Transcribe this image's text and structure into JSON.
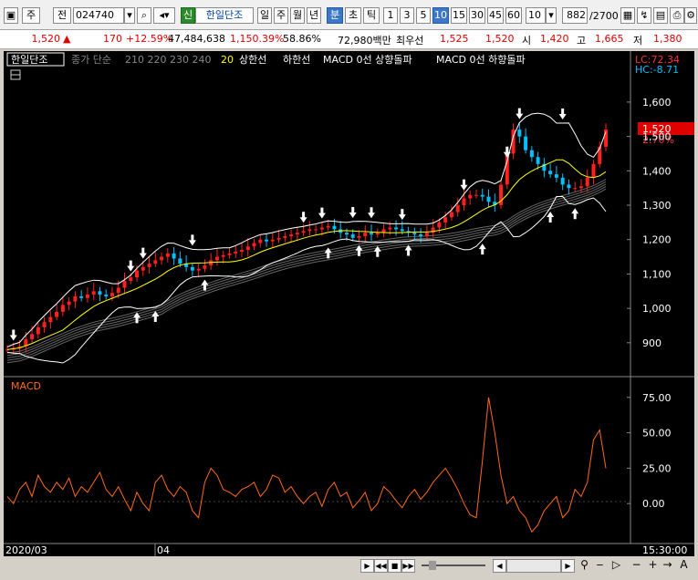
{
  "toolbar": {
    "kind": "주",
    "period_type": "전",
    "code": "024740",
    "badge": "신",
    "name": "한일단조",
    "periods": [
      "일",
      "주",
      "월",
      "년",
      "분",
      "초",
      "틱"
    ],
    "minutes": [
      "1",
      "3",
      "5",
      "10",
      "15",
      "30",
      "45",
      "60"
    ],
    "count": "10",
    "position": "882",
    "total": "/2700"
  },
  "quote": {
    "price": "1,520",
    "arrow": "▲",
    "change": "170",
    "change_rate": "+12.59%",
    "volume": "47,484,638",
    "volume_rate": "1,150.39%",
    "turnover": "58.86%",
    "amount": "72,980백만",
    "priority": "최우선",
    "ask": "1,525",
    "bid": "1,520",
    "open_label": "시",
    "open": "1,420",
    "high_label": "고",
    "high": "1,665",
    "low_label": "저",
    "low": "1,380"
  },
  "legend": {
    "stock": "한일단조",
    "ma_label": "종가 단순",
    "ma_periods": "210  220  230  240",
    "ma20": "20",
    "upper": "상한선",
    "lower": "하한선",
    "macd_up": "MACD 0선 상향돌파",
    "macd_down": "MACD 0선 하향돌파",
    "lc": "LC:72.34",
    "hc": "HC:-8.71"
  },
  "price_box": {
    "price": "1,520",
    "pct": "2.70%"
  },
  "macd_title": "MACD",
  "x_axis": {
    "start": "2020/03",
    "mid": "04",
    "time": "15:30:00"
  },
  "colors": {
    "up": "#ff2020",
    "down": "#00c0ff",
    "ma20": "#ffff00",
    "band": "#ffffff",
    "macd": "#ff6a1a",
    "grid": "#555555",
    "accent": "#3c78c8"
  },
  "chart_data": [
    {
      "type": "line",
      "title": "",
      "y_ticks": [
        "1,600",
        "1,500",
        "1,400",
        "1,300",
        "1,200",
        "1,100",
        "1,000",
        "900"
      ],
      "ylim": [
        820,
        1690
      ],
      "current": 1520,
      "close": [
        880,
        885,
        890,
        910,
        925,
        945,
        960,
        975,
        990,
        1010,
        1020,
        1035,
        1030,
        1040,
        1050,
        1040,
        1035,
        1045,
        1060,
        1080,
        1090,
        1110,
        1120,
        1130,
        1140,
        1150,
        1160,
        1145,
        1130,
        1120,
        1110,
        1115,
        1125,
        1140,
        1150,
        1155,
        1160,
        1165,
        1170,
        1180,
        1190,
        1200,
        1195,
        1200,
        1205,
        1210,
        1215,
        1220,
        1225,
        1230,
        1230,
        1235,
        1240,
        1230,
        1220,
        1215,
        1205,
        1210,
        1220,
        1215,
        1220,
        1230,
        1235,
        1230,
        1225,
        1220,
        1215,
        1210,
        1220,
        1235,
        1250,
        1265,
        1280,
        1300,
        1320,
        1330,
        1330,
        1325,
        1310,
        1300,
        1360,
        1450,
        1520,
        1500,
        1460,
        1440,
        1420,
        1400,
        1390,
        1380,
        1360,
        1350,
        1350,
        1355,
        1380,
        1420,
        1470,
        1520
      ]
    },
    {
      "type": "line",
      "title": "MACD",
      "y_ticks": [
        "75.00",
        "50.00",
        "25.00",
        "0.00"
      ],
      "ylim": [
        -25,
        80
      ],
      "values": [
        5,
        0,
        10,
        15,
        5,
        20,
        12,
        8,
        15,
        10,
        18,
        5,
        12,
        8,
        15,
        22,
        10,
        5,
        12,
        3,
        -5,
        8,
        0,
        -5,
        15,
        20,
        10,
        5,
        12,
        8,
        -5,
        -10,
        15,
        25,
        20,
        10,
        8,
        5,
        10,
        12,
        15,
        5,
        10,
        20,
        18,
        8,
        12,
        5,
        0,
        5,
        8,
        -2,
        10,
        15,
        5,
        8,
        -3,
        2,
        8,
        -5,
        0,
        12,
        8,
        2,
        -3,
        5,
        10,
        3,
        8,
        15,
        20,
        25,
        18,
        10,
        0,
        -8,
        -10,
        30,
        75,
        50,
        20,
        0,
        5,
        -5,
        -10,
        -20,
        -15,
        -5,
        0,
        5,
        -10,
        -5,
        10,
        5,
        15,
        45,
        52,
        25
      ]
    }
  ]
}
